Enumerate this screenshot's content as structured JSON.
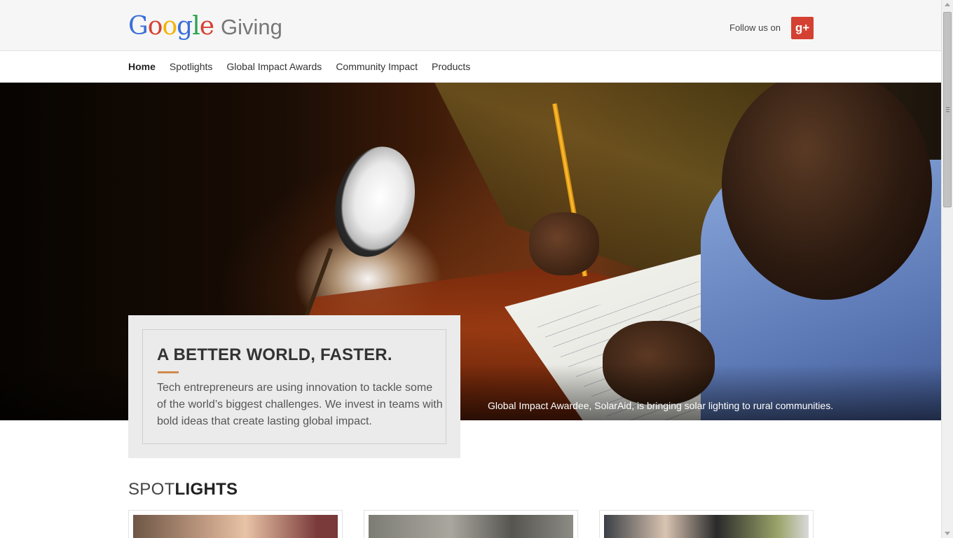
{
  "header": {
    "logo_letters": [
      {
        "ch": "G",
        "color": "#3b6fd8"
      },
      {
        "ch": "o",
        "color": "#d64131"
      },
      {
        "ch": "o",
        "color": "#f2b400"
      },
      {
        "ch": "g",
        "color": "#3b6fd8"
      },
      {
        "ch": "l",
        "color": "#2ba24a"
      },
      {
        "ch": "e",
        "color": "#d64131"
      }
    ],
    "logo_suffix": "Giving",
    "follow_label": "Follow us on",
    "gplus_label": "g+"
  },
  "nav": {
    "items": [
      {
        "label": "Home",
        "active": true
      },
      {
        "label": "Spotlights",
        "active": false
      },
      {
        "label": "Global Impact Awards",
        "active": false
      },
      {
        "label": "Community Impact",
        "active": false
      },
      {
        "label": "Products",
        "active": false
      }
    ]
  },
  "hero": {
    "caption": "Global Impact Awardee, SolarAid, is bringing solar lighting to rural communities.",
    "feature_title": "A BETTER WORLD, FASTER.",
    "feature_body": "Tech entrepreneurs are using innovation to tackle some of the world’s biggest challenges. We invest in teams with bold ideas that create lasting global impact."
  },
  "spotlights": {
    "title_light": "SPOT",
    "title_bold": "LIGHTS"
  },
  "colors": {
    "accent": "#d08a4c",
    "gplus": "#d44132"
  }
}
